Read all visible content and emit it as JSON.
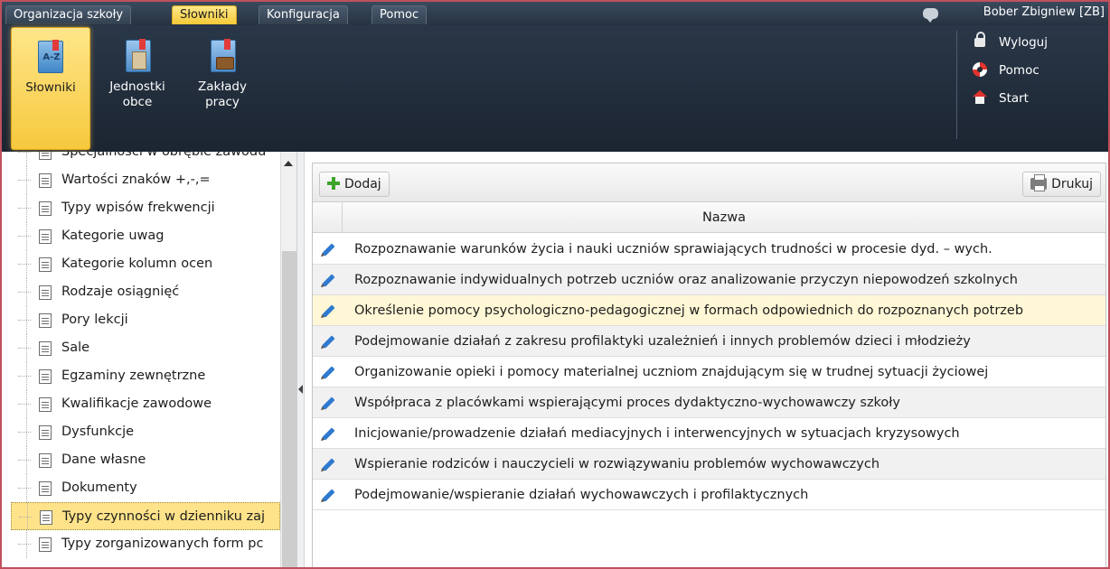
{
  "menu": {
    "tabs": [
      {
        "label": "Organizacja szkoły",
        "active": false
      },
      {
        "label": "Słowniki",
        "active": true
      },
      {
        "label": "Konfiguracja",
        "active": false
      },
      {
        "label": "Pomoc",
        "active": false
      }
    ],
    "user_name": "Bober Zbigniew [ZB]",
    "chat_icon": "chat-bubble-icon"
  },
  "ribbon": {
    "buttons": [
      {
        "label": "Słowniki",
        "icon": "dictionary-az-icon",
        "active": true
      },
      {
        "label": "Jednostki\nobce",
        "icon": "building-icon",
        "active": false
      },
      {
        "label": "Zakłady\npracy",
        "icon": "briefcase-icon",
        "active": false
      }
    ],
    "side_links": [
      {
        "label": "Wyloguj",
        "icon": "lock-icon"
      },
      {
        "label": "Pomoc",
        "icon": "lifebuoy-icon"
      },
      {
        "label": "Start",
        "icon": "home-icon"
      }
    ]
  },
  "tree": {
    "items": [
      {
        "label": "Specjalności w obrębie zawodu",
        "selected": false
      },
      {
        "label": "Wartości znaków +,-,=",
        "selected": false
      },
      {
        "label": "Typy wpisów frekwencji",
        "selected": false
      },
      {
        "label": "Kategorie uwag",
        "selected": false
      },
      {
        "label": "Kategorie kolumn ocen",
        "selected": false
      },
      {
        "label": "Rodzaje osiągnięć",
        "selected": false
      },
      {
        "label": "Pory lekcji",
        "selected": false
      },
      {
        "label": "Sale",
        "selected": false
      },
      {
        "label": "Egzaminy zewnętrzne",
        "selected": false
      },
      {
        "label": "Kwalifikacje zawodowe",
        "selected": false
      },
      {
        "label": "Dysfunkcje",
        "selected": false
      },
      {
        "label": "Dane własne",
        "selected": false
      },
      {
        "label": "Dokumenty",
        "selected": false
      },
      {
        "label": "Typy czynności w dzienniku zaj",
        "selected": true
      },
      {
        "label": "Typy zorganizowanych form pc",
        "selected": false
      }
    ]
  },
  "toolbar": {
    "add_label": "Dodaj",
    "print_label": "Drukuj"
  },
  "grid": {
    "column_header": "Nazwa",
    "rows": [
      "Rozpoznawanie warunków życia i nauki uczniów sprawiających trudności w procesie dyd. – wych.",
      "Rozpoznawanie indywidualnych potrzeb uczniów oraz analizowanie przyczyn niepowodzeń szkolnych",
      "Określenie pomocy psychologiczno-pedagogicznej w formach odpowiednich do rozpoznanych potrzeb",
      "Podejmowanie działań z zakresu profilaktyki uzależnień i innych problemów dzieci i młodzieży",
      "Organizowanie opieki i pomocy materialnej uczniom znajdującym się w trudnej sytuacji życiowej",
      "Współpraca z placówkami wspierającymi proces dydaktyczno-wychowawczy szkoły",
      "Inicjowanie/prowadzenie działań mediacyjnych i interwencyjnych w sytuacjach kryzysowych",
      "Wspieranie rodziców i nauczycieli w rozwiązywaniu problemów wychowawczych",
      "Podejmowanie/wspieranie działań wychowawczych i profilaktycznych"
    ],
    "highlighted_row": 2
  },
  "colors": {
    "accent_yellow": "#f5c937",
    "selected_tree": "#ffe38a",
    "row_highlight": "#fff7d6",
    "dark_bar": "#26323f"
  }
}
